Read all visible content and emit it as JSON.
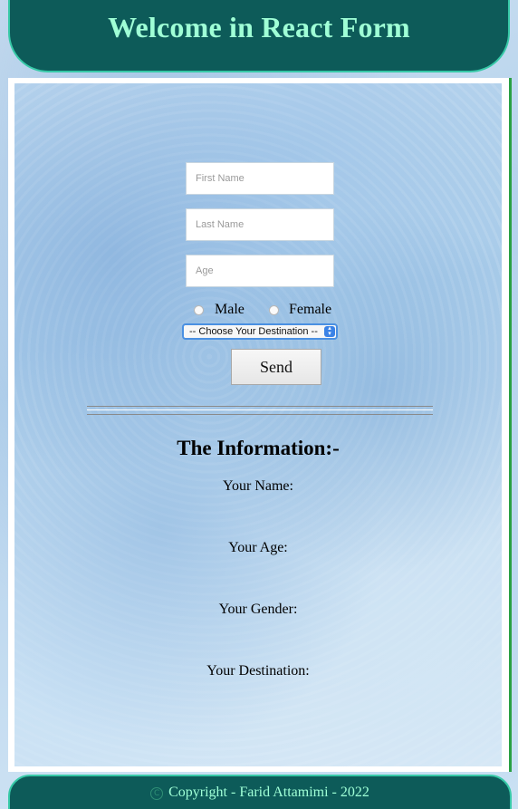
{
  "header": {
    "title": "Welcome in React Form"
  },
  "form": {
    "first_name": {
      "placeholder": "First Name",
      "value": ""
    },
    "last_name": {
      "placeholder": "Last Name",
      "value": ""
    },
    "age": {
      "placeholder": "Age",
      "value": ""
    },
    "gender": {
      "options": [
        "Male",
        "Female"
      ]
    },
    "destination": {
      "selected": "-- Choose Your Destination --"
    },
    "send_label": "Send"
  },
  "info": {
    "title": "The Information:-",
    "name_label": "Your Name:",
    "age_label": "Your Age:",
    "gender_label": "Your Gender:",
    "destination_label": "Your Destination:"
  },
  "footer": {
    "text": "Copyright - Farid Attamimi - 2022",
    "icon": "copyright-icon"
  },
  "colors": {
    "header_bg": "#0d5b59",
    "header_text": "#9fffd6",
    "accent_border": "#37c9a7"
  }
}
